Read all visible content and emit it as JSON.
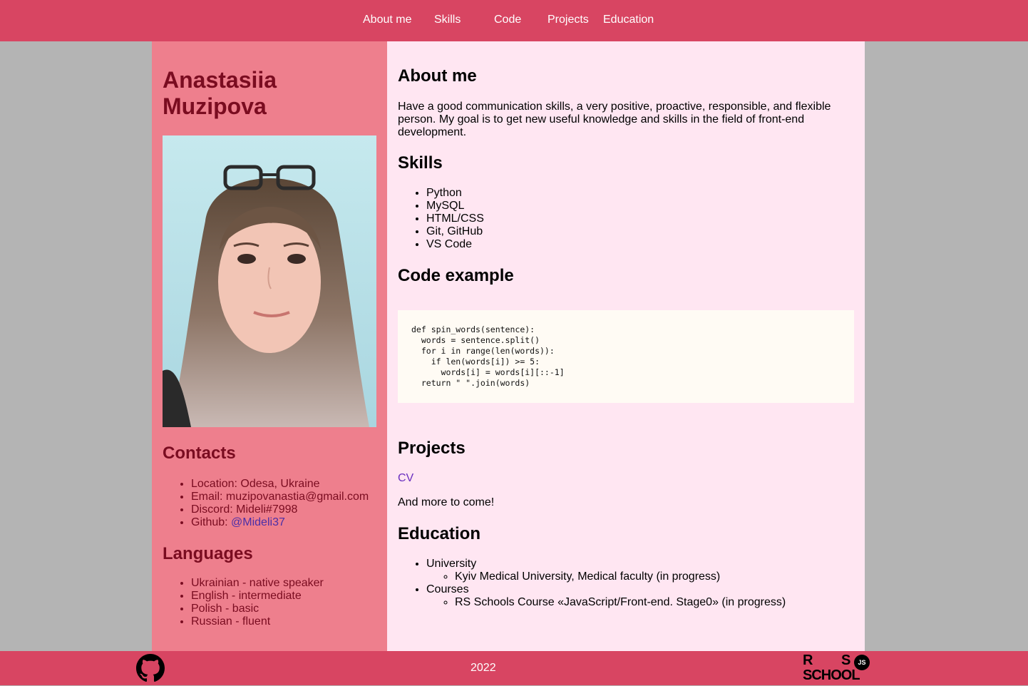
{
  "nav": {
    "items": [
      "About me",
      "Skills",
      "Code",
      "Projects",
      "Education"
    ]
  },
  "sidebar": {
    "name_line1": "Anastasiia",
    "name_line2": "Muzipova",
    "contacts_title": "Contacts",
    "contacts": {
      "location": "Location: Odesa, Ukraine",
      "email": "Email: muzipovanastia@gmail.com",
      "discord": "Discord: Mideli#7998",
      "github_prefix": "Github: ",
      "github_link": "@Mideli37"
    },
    "languages_title": "Languages",
    "languages": [
      "Ukrainian - native speaker",
      "English - intermediate",
      "Polish - basic",
      "Russian - fluent"
    ]
  },
  "main": {
    "about_title": "About me",
    "about_text": "Have a good communication skills, a very positive, proactive, responsible, and flexible person. My goal is to get new useful knowledge and skills in the field of front-end development.",
    "skills_title": "Skills",
    "skills": [
      "Python",
      "MySQL",
      "HTML/CSS",
      "Git, GitHub",
      "VS Code"
    ],
    "code_title": "Code example",
    "code": "def spin_words(sentence):\n  words = sentence.split()\n  for i in range(len(words)):\n    if len(words[i]) >= 5:\n      words[i] = words[i][::-1]\n  return \" \".join(words)",
    "projects_title": "Projects",
    "project_link": "CV",
    "projects_more": "And more to come!",
    "education_title": "Education",
    "education": {
      "university_label": "University",
      "university_item": "Kyiv Medical University, Medical faculty (in progress)",
      "courses_label": "Courses",
      "courses_item": "RS Schools Course «JavaScript/Front-end. Stage0» (in progress)"
    }
  },
  "footer": {
    "year": "2022",
    "logo": {
      "r": "R",
      "s": "S",
      "js": "JS",
      "school": "SCHOOL"
    }
  },
  "colors": {
    "header": "#d84562",
    "sidebar": "#ee7f8d",
    "main": "#ffe6f2",
    "accent_text": "#7a0c20",
    "link": "#4b2fa8"
  },
  "icons": [
    "github-icon",
    "rs-school-logo"
  ]
}
